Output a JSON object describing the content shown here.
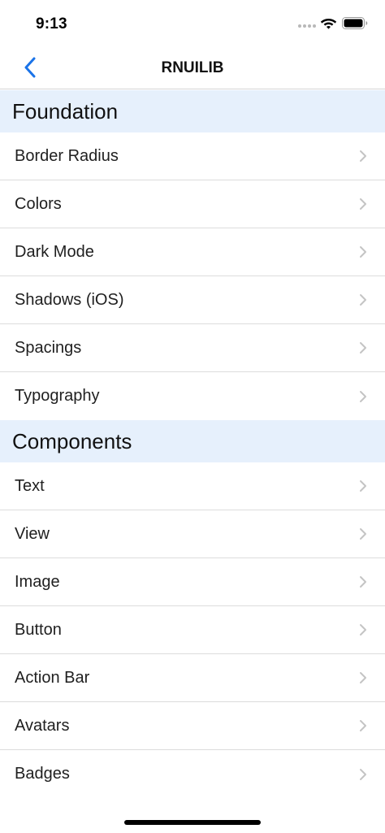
{
  "status_bar": {
    "time": "9:13"
  },
  "nav": {
    "title": "RNUILIB",
    "back_icon": "chevron-left-icon"
  },
  "sections": [
    {
      "title": "Foundation",
      "items": [
        {
          "label": "Border Radius"
        },
        {
          "label": "Colors"
        },
        {
          "label": "Dark Mode"
        },
        {
          "label": "Shadows (iOS)"
        },
        {
          "label": "Spacings"
        },
        {
          "label": "Typography"
        }
      ]
    },
    {
      "title": "Components",
      "items": [
        {
          "label": "Text"
        },
        {
          "label": "View"
        },
        {
          "label": "Image"
        },
        {
          "label": "Button"
        },
        {
          "label": "Action Bar"
        },
        {
          "label": "Avatars"
        },
        {
          "label": "Badges"
        }
      ]
    }
  ],
  "colors": {
    "accent": "#1a73e8",
    "section_background": "#e6f0fc",
    "divider": "#dcdcdc",
    "chevron": "#c4c4c4"
  }
}
